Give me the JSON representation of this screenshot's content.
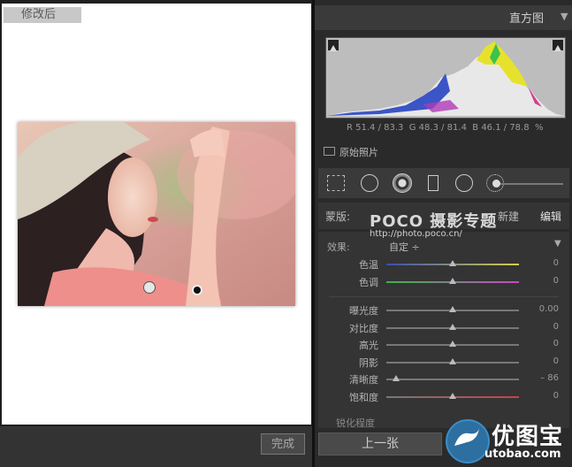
{
  "left": {
    "badge": "修改后",
    "done_button": "完成"
  },
  "histogram": {
    "title": "直方图",
    "readout": "R 51.4 / 83.3  G 48.3 / 81.4  B 46.1 / 78.8  %",
    "original_photo_label": "原始照片"
  },
  "presets": {
    "label": "蒙版:",
    "new_label": "新建",
    "edit_label": "编辑"
  },
  "watermark_poco": {
    "logo": "POCO 摄影专题",
    "url": "http://photo.poco.cn/"
  },
  "adjustments": {
    "effect_label": "效果:",
    "effect_value": "自定 ÷",
    "groups": [
      [
        {
          "label": "色温",
          "value": "0",
          "level": 0.5,
          "gradient": "linear-gradient(90deg,#3a4db0,#d6d04a)"
        },
        {
          "label": "色调",
          "value": "0",
          "level": 0.5,
          "gradient": "linear-gradient(90deg,#3fb24b,#c34bc4)"
        }
      ],
      [
        {
          "label": "曝光度",
          "value": "0.00",
          "level": 0.5,
          "gradient": ""
        },
        {
          "label": "对比度",
          "value": "0",
          "level": 0.5,
          "gradient": ""
        },
        {
          "label": "高光",
          "value": "0",
          "level": 0.5,
          "gradient": ""
        },
        {
          "label": "阴影",
          "value": "0",
          "level": 0.5,
          "gradient": ""
        },
        {
          "label": "清晰度",
          "value": "– 86",
          "level": 0.07,
          "gradient": ""
        },
        {
          "label": "饱和度",
          "value": "0",
          "level": 0.5,
          "gradient": "linear-gradient(90deg,#777,#c3434a)"
        }
      ]
    ],
    "cutoff_label": "锐化程度"
  },
  "bottom": {
    "prev_button": "上一张"
  },
  "watermark_site": {
    "name": "优图宝",
    "url": "utobao.com"
  },
  "colors": {
    "panel": "#2b2b2b",
    "accent_blue": "#3b8dc8"
  }
}
